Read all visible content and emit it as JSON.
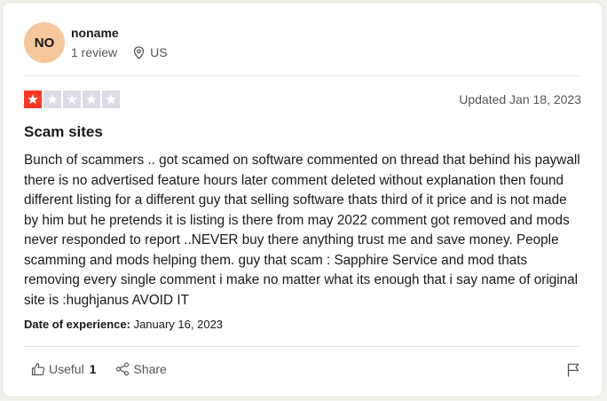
{
  "reviewer": {
    "initials": "NO",
    "name": "noname",
    "review_count": "1 review",
    "country": "US",
    "avatar_color": "#f6c79b"
  },
  "review": {
    "rating": 1,
    "rating_max": 5,
    "star_color": "#ff3722",
    "star_empty_color": "#dcdce6",
    "updated": "Updated Jan 18, 2023",
    "title": "Scam sites",
    "body": "Bunch of scammers .. got scamed on software commented on thread that behind his paywall there is no advertised feature hours later comment deleted without explanation then found different listing for a different guy that selling software thats third of it price and is not made by him but he pretends it is listing is there from may 2022 comment got removed and mods never responded to report ..NEVER buy there anything trust me and save money. People scamming and mods helping them. guy that scam : Sapphire Service and mod thats removing every single comment i make no matter what its enough that i say name of original site is :hughjanus AVOID IT",
    "experience_label": "Date of experience:",
    "experience_date": "January 16, 2023"
  },
  "actions": {
    "useful_label": "Useful",
    "useful_count": "1",
    "share_label": "Share"
  },
  "icons": {
    "location": "location-pin-icon",
    "star": "star-icon",
    "thumbs_up": "thumbs-up-icon",
    "share": "share-icon",
    "flag": "flag-icon"
  }
}
